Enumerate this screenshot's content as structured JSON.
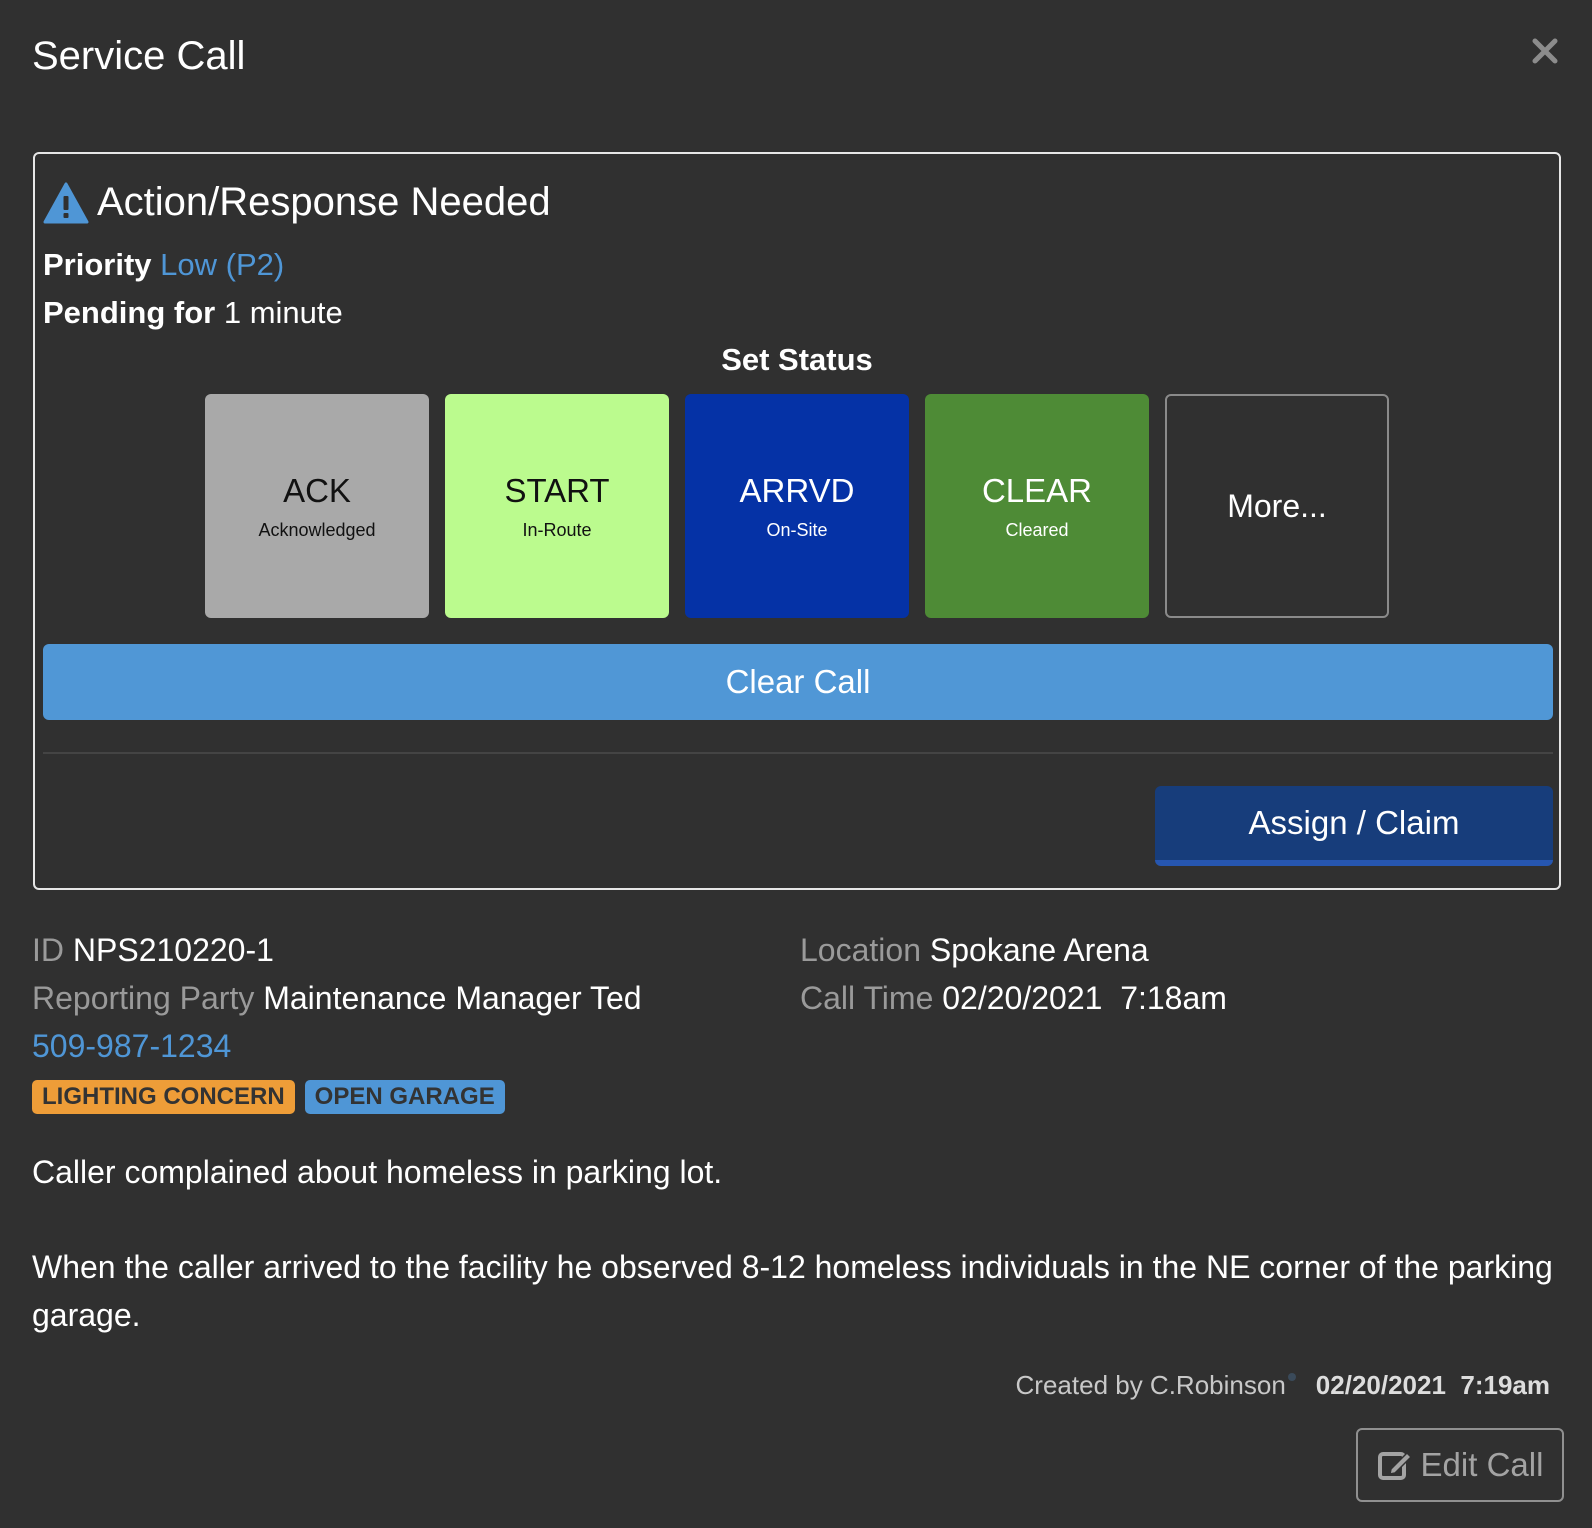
{
  "modal": {
    "title": "Service Call",
    "close_icon": "close-icon"
  },
  "alert": {
    "icon": "warning-triangle-icon",
    "title": "Action/Response Needed",
    "priority_label": "Priority",
    "priority_value": "Low (P2)",
    "pending_label": "Pending for",
    "pending_value": "1 minute",
    "set_status_label": "Set Status"
  },
  "status_buttons": [
    {
      "code": "ACK",
      "sub": "Acknowledged",
      "color": "#a9a9a9"
    },
    {
      "code": "START",
      "sub": "In-Route",
      "color": "#bbfb8e"
    },
    {
      "code": "ARRVD",
      "sub": "On-Site",
      "color": "#0532a6"
    },
    {
      "code": "CLEAR",
      "sub": "Cleared",
      "color": "#4e8b36"
    },
    {
      "code": "More...",
      "sub": ""
    }
  ],
  "actions": {
    "clear_call": "Clear Call",
    "assign_claim": "Assign / Claim",
    "edit_call": "Edit Call"
  },
  "details": {
    "id_label": "ID",
    "id_value": "NPS210220-1",
    "reporting_label": "Reporting Party",
    "reporting_value": "Maintenance Manager Ted",
    "phone": "509-987-1234",
    "location_label": "Location",
    "location_value": "Spokane Arena",
    "calltime_label": "Call Time",
    "calltime_value": "02/20/2021  7:18am"
  },
  "tags": [
    {
      "label": "LIGHTING CONCERN",
      "color": "#ee9d38"
    },
    {
      "label": "OPEN GARAGE",
      "color": "#4f96d6"
    }
  ],
  "description": [
    "Caller complained about homeless in parking lot.",
    "When the caller arrived to the facility he observed 8-12 homeless individuals in the NE corner of the parking garage."
  ],
  "footer": {
    "created_by": "Created by C.Robinson",
    "created_at": "02/20/2021  7:19am"
  },
  "colors": {
    "background": "#303030",
    "accent_blue": "#4f96d6",
    "assign_blue": "#173d7b"
  }
}
